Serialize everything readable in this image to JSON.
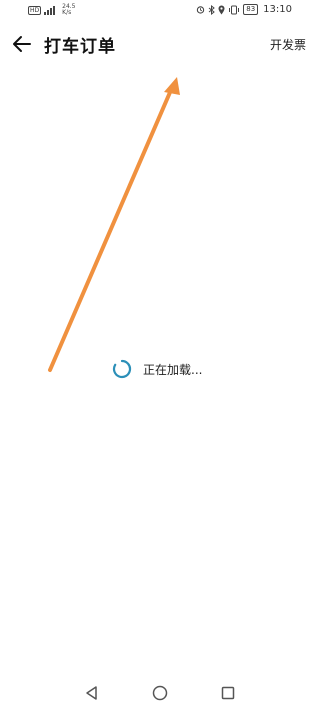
{
  "status_bar": {
    "hd_label": "HD",
    "speed_value": "24.5",
    "speed_unit": "K/s",
    "battery": "83",
    "time": "13:10"
  },
  "app_bar": {
    "title": "打车订单",
    "action_label": "开发票"
  },
  "loading": {
    "text": "正在加载...",
    "spinner_color": "#2b8fb8"
  },
  "overlay": {
    "arrow_color": "#f0913f"
  },
  "icons": {
    "back": "arrow-left-icon",
    "nav_back": "triangle-back-icon",
    "nav_home": "circle-home-icon",
    "nav_recent": "square-recent-icon"
  }
}
